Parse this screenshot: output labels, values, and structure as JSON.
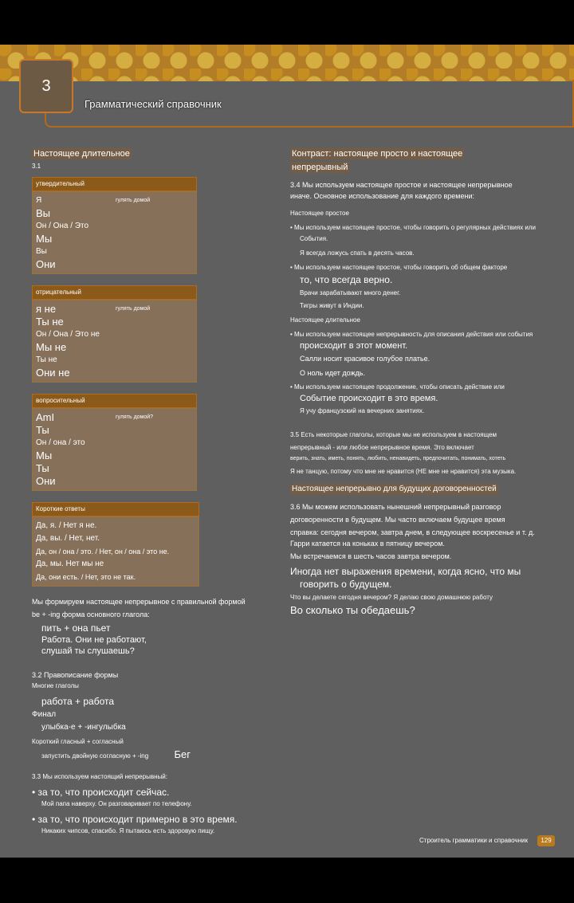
{
  "header": {
    "unit": "3",
    "title": "Грамматический справочник"
  },
  "left": {
    "title": "Настоящее длительное",
    "num": "3.1",
    "affirm": {
      "head": "утвердительный",
      "note": "гулять домой",
      "rows": [
        "Я",
        "Вы",
        "Он / Она / Это",
        "Мы",
        "Вы",
        "Они"
      ]
    },
    "neg": {
      "head": "отрицательный",
      "note": "гулять домой",
      "rows": [
        "я не",
        "Ты не",
        "Он / Она / Это не",
        "Мы не",
        "Ты не",
        "Они не"
      ]
    },
    "quest": {
      "head": "вопросительный",
      "note": "гулять домой?",
      "rows": [
        "AmI",
        "Ты",
        "Он / она / это",
        "Мы",
        "Ты",
        "Они"
      ]
    },
    "short": {
      "head": "Короткие ответы",
      "rows": [
        "Да, я. / Нет я не.",
        "Да, вы. / Нет, нет.",
        "Да, он / она / это. / Нет, он / она / это не.",
        "Да, мы. Нет мы не",
        "Да, они есть. / Нет, это не так."
      ]
    },
    "form1": "Мы формируем настоящее непрерывное с правильной формой",
    "form2": "be + -ing форма основного глагола:",
    "ex1": "пить + она пьет",
    "ex2": "Работа. Они не работают,",
    "ex3": "слушай ты слушаешь?",
    "s32": "3.2 Правописание формы",
    "s32a": "Многие глаголы",
    "s32b": "работа + работа",
    "s32c": "Финал",
    "s32d": "улыбка-е + -ингулыбка",
    "s32e": "Короткий гласный + согласный",
    "s32f": "запустить двойную согласную + -ing",
    "s32g": "Бег",
    "s33": "3.3 Мы используем настоящий непрерывный:",
    "b1": "• за то, что происходит сейчас.",
    "b1ex": "Мой папа наверху. Он разговаривает по телефону.",
    "b2": "• за то, что происходит примерно в это время.",
    "b2ex": "Никаких чипсов, спасибо. Я пытаюсь есть здоровую пищу."
  },
  "right": {
    "title1": "Контраст: настоящее просто и настоящее",
    "title2": "непрерывный",
    "p34a": "3.4 Мы используем настоящее простое и настоящее непрерывное",
    "p34b": "иначе. Основное использование для каждого времени:",
    "ps": "Настоящее простое",
    "ps1": "• Мы используем настоящее простое, чтобы говорить о регулярных действиях или",
    "ps1b": "События.",
    "ps1ex": "Я всегда ложусь спать в десять часов.",
    "ps2": "• Мы используем настоящее простое, чтобы говорить об общем факторе",
    "ps2b": "то, что всегда верно.",
    "ps2ex1": "Врачи зарабатывают много денег.",
    "ps2ex2": "Тигры живут в Индии.",
    "pc": "Настоящее длительное",
    "pc1": "• Мы используем настоящее непрерывность для описания действия или события",
    "pc1b": "происходит в этот момент.",
    "pc1ex1": "Салли носит красивое голубое платье.",
    "pc1ex2": "О ноль идет дождь.",
    "pc2": "• Мы используем настоящее продолжение, чтобы описать действие или",
    "pc2b": "Событие происходит в это время.",
    "pc2ex": "Я учу французский на вечерних занятиях.",
    "p35a": "3.5 Есть некоторые глаголы, которые мы не используем в настоящем",
    "p35b": "непрерывный - или любое непрерывное время. Это включает",
    "p35c": "верить, знать, иметь, понять, любить, ненавидеть, предпочитать, понимать, хотеть",
    "p35d": "Я не танцую, потому что мне не нравится (НЕ мне не нравится) эта музыка.",
    "title3": "Настоящее непрерывно для будущих договоренностей",
    "p36a": "3.6  Мы можем использовать нынешний непрерывный разговор",
    "p36b": "договоренности в будущем. Мы часто включаем будущее время",
    "p36c": "справка: сегодня вечером, завтра днем, в следующее воскресенье и т. д.",
    "p36d": "Гарри катается на коньках в пятницу вечером.",
    "p36e": "Мы встречаемся в шесть часов завтра вечером.",
    "p36f": "Иногда нет выражения времени, когда ясно, что мы",
    "p36g": "говорить о будущем.",
    "p36h": "Что вы делаете сегодня вечером? Я делаю свою домашнюю работу",
    "p36i": "Во сколько ты обедаешь?"
  },
  "footer": {
    "text": "Строитель грамматики и справочник",
    "page": "129"
  }
}
